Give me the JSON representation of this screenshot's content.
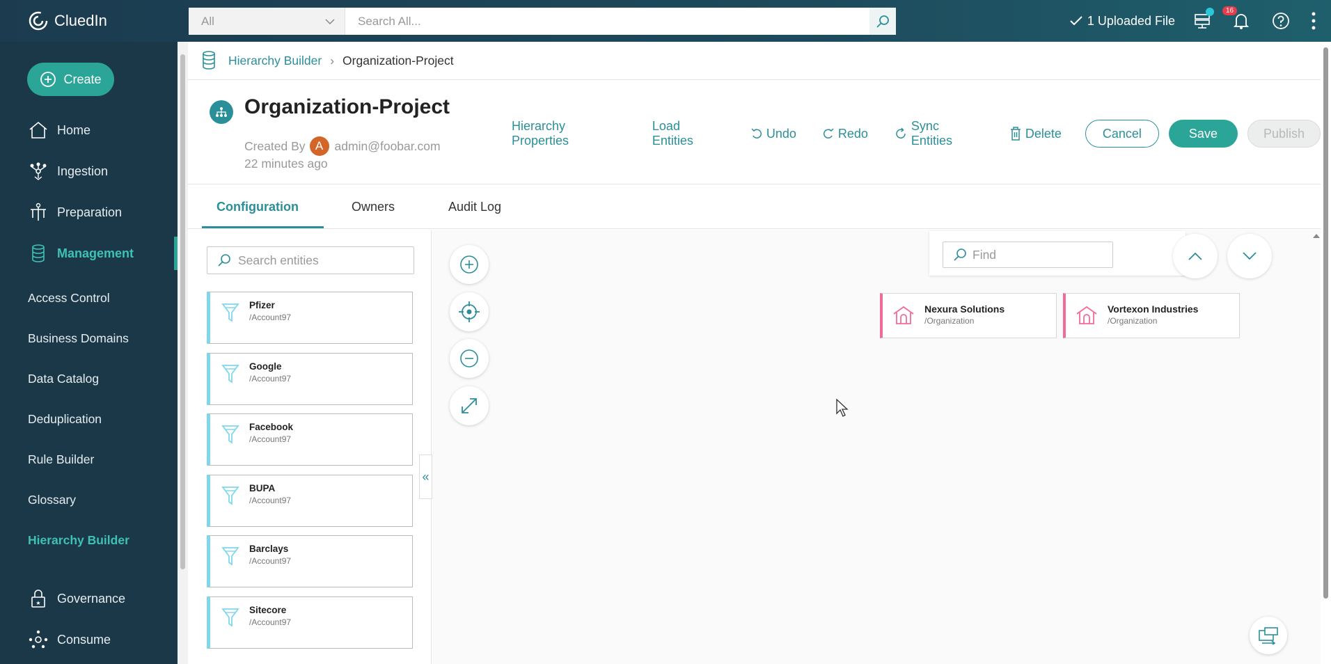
{
  "app": {
    "name": "CluedIn"
  },
  "topbar": {
    "search_scope": "All",
    "search_placeholder": "Search All...",
    "uploaded_label": "1 Uploaded File",
    "notification_count": "16"
  },
  "sidebar": {
    "create_label": "Create",
    "nav": [
      {
        "label": "Home"
      },
      {
        "label": "Ingestion"
      },
      {
        "label": "Preparation"
      },
      {
        "label": "Management"
      }
    ],
    "sub_items": [
      {
        "label": "Access Control"
      },
      {
        "label": "Business Domains"
      },
      {
        "label": "Data Catalog"
      },
      {
        "label": "Deduplication"
      },
      {
        "label": "Rule Builder"
      },
      {
        "label": "Glossary"
      },
      {
        "label": "Hierarchy Builder"
      }
    ],
    "nav_bottom": [
      {
        "label": "Governance"
      },
      {
        "label": "Consume"
      }
    ]
  },
  "breadcrumb": {
    "parent": "Hierarchy Builder",
    "current": "Organization-Project"
  },
  "header": {
    "title": "Organization-Project",
    "created_by_label": "Created By",
    "avatar_letter": "A",
    "created_by_user": "admin@foobar.com",
    "time_ago": "22 minutes ago",
    "actions": {
      "hierarchy_properties": "Hierarchy Properties",
      "load_entities": "Load Entities",
      "undo": "Undo",
      "redo": "Redo",
      "sync_entities": "Sync Entities",
      "delete": "Delete",
      "cancel": "Cancel",
      "save": "Save",
      "publish": "Publish"
    }
  },
  "tabs": [
    {
      "label": "Configuration"
    },
    {
      "label": "Owners"
    },
    {
      "label": "Audit Log"
    }
  ],
  "entities": {
    "search_placeholder": "Search entities",
    "items": [
      {
        "name": "Pfizer",
        "type": "/Account97"
      },
      {
        "name": "Google",
        "type": "/Account97"
      },
      {
        "name": "Facebook",
        "type": "/Account97"
      },
      {
        "name": "BUPA",
        "type": "/Account97"
      },
      {
        "name": "Barclays",
        "type": "/Account97"
      },
      {
        "name": "Sitecore",
        "type": "/Account97"
      }
    ]
  },
  "canvas": {
    "find_placeholder": "Find",
    "nodes": [
      {
        "name": "Nexura Solutions",
        "type": "/Organization"
      },
      {
        "name": "Vortexon Industries",
        "type": "/Organization"
      }
    ]
  },
  "colors": {
    "accent": "#2b8f99",
    "sidebar_bg": "#1a3848",
    "primary_button": "#2ba597",
    "node_border": "#f06b9a",
    "entity_border": "#7fd8ea"
  }
}
